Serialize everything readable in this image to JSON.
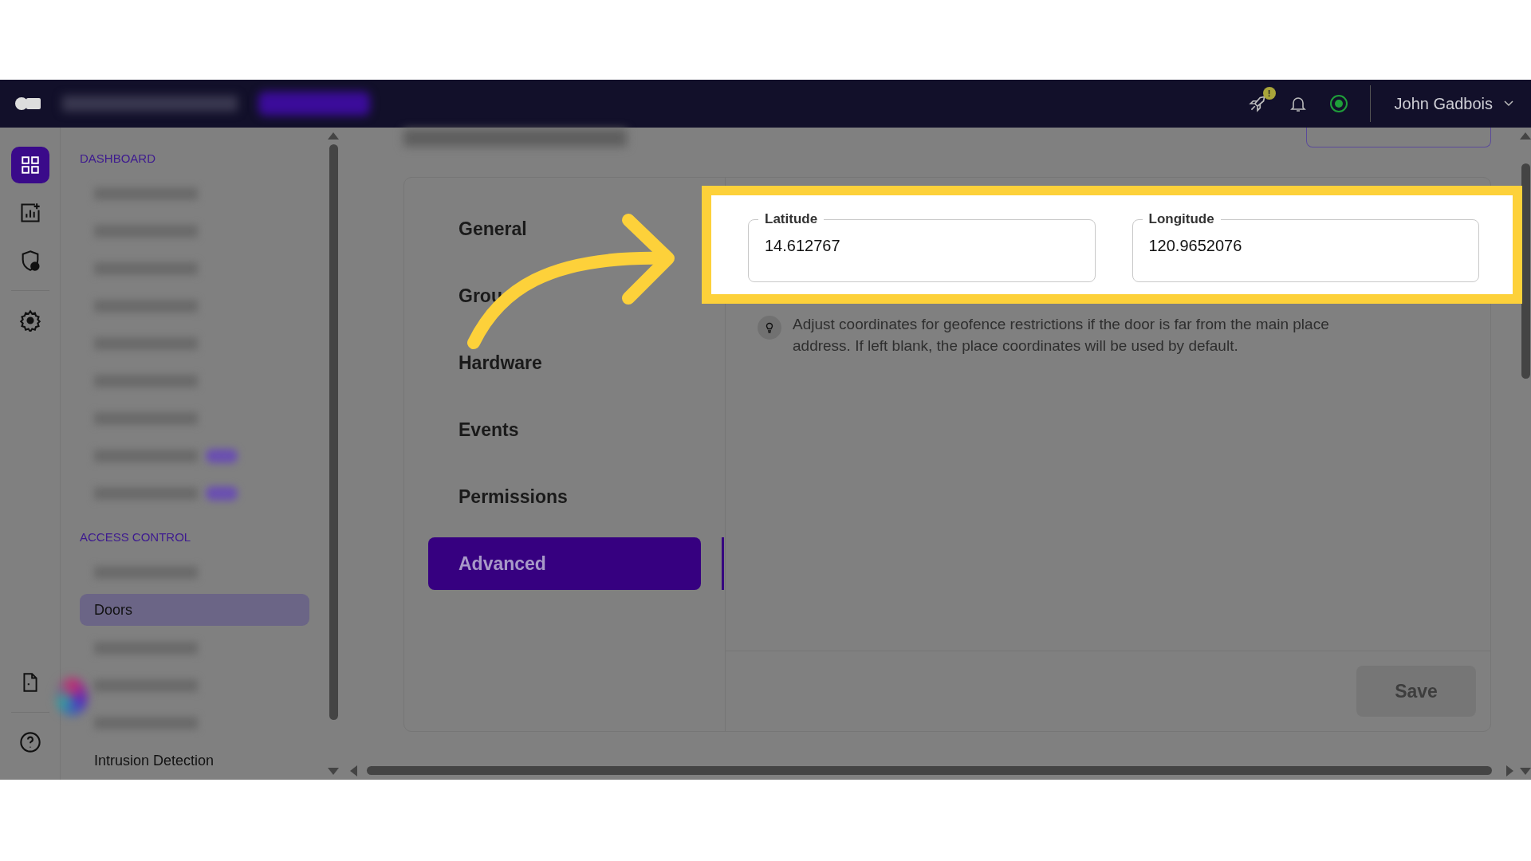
{
  "topbar": {
    "user_name": "John Gadbois",
    "alert_badge": "!"
  },
  "rail": [
    {
      "kind": "grid",
      "selected": true
    },
    {
      "kind": "chart",
      "selected": false
    },
    {
      "kind": "shield",
      "selected": false
    },
    {
      "kind": "gear",
      "selected": false
    },
    {
      "kind": "doc",
      "selected": false
    },
    {
      "kind": "help",
      "selected": false
    }
  ],
  "sidebar": {
    "sections": [
      {
        "title": "DASHBOARD",
        "items": [
          {
            "kind": "blurred",
            "selected": false
          },
          {
            "kind": "blurred",
            "selected": false
          },
          {
            "kind": "blurred",
            "selected": false
          },
          {
            "kind": "blurred",
            "selected": false
          },
          {
            "kind": "blurred",
            "selected": false
          },
          {
            "kind": "blurred",
            "selected": false
          },
          {
            "kind": "blurred",
            "selected": false
          },
          {
            "kind": "blurred-badge",
            "selected": false
          },
          {
            "kind": "blurred-badge",
            "selected": false
          }
        ]
      },
      {
        "title": "ACCESS CONTROL",
        "items": [
          {
            "kind": "blurred",
            "selected": false
          },
          {
            "kind": "text",
            "label": "Doors",
            "selected": true
          },
          {
            "kind": "blurred",
            "selected": false
          },
          {
            "kind": "blurred",
            "selected": false
          },
          {
            "kind": "blurred",
            "selected": false
          },
          {
            "kind": "text",
            "label": "Intrusion Detection",
            "selected": false
          }
        ]
      }
    ]
  },
  "tabs": [
    {
      "label": "General",
      "selected": false
    },
    {
      "label": "Grou",
      "selected": false
    },
    {
      "label": "Hardware",
      "selected": false
    },
    {
      "label": "Events",
      "selected": false
    },
    {
      "label": "Permissions",
      "selected": false
    },
    {
      "label": "Advanced",
      "selected": true
    }
  ],
  "fields": [
    {
      "label": "Latitude",
      "value": "14.612767"
    },
    {
      "label": "Longitude",
      "value": "120.9652076"
    }
  ],
  "hint": "Adjust coordinates for geofence restrictions if the door is far from the main place address. If left blank, the place coordinates will be used by default.",
  "save_button": {
    "label": "Save",
    "disabled": true
  }
}
